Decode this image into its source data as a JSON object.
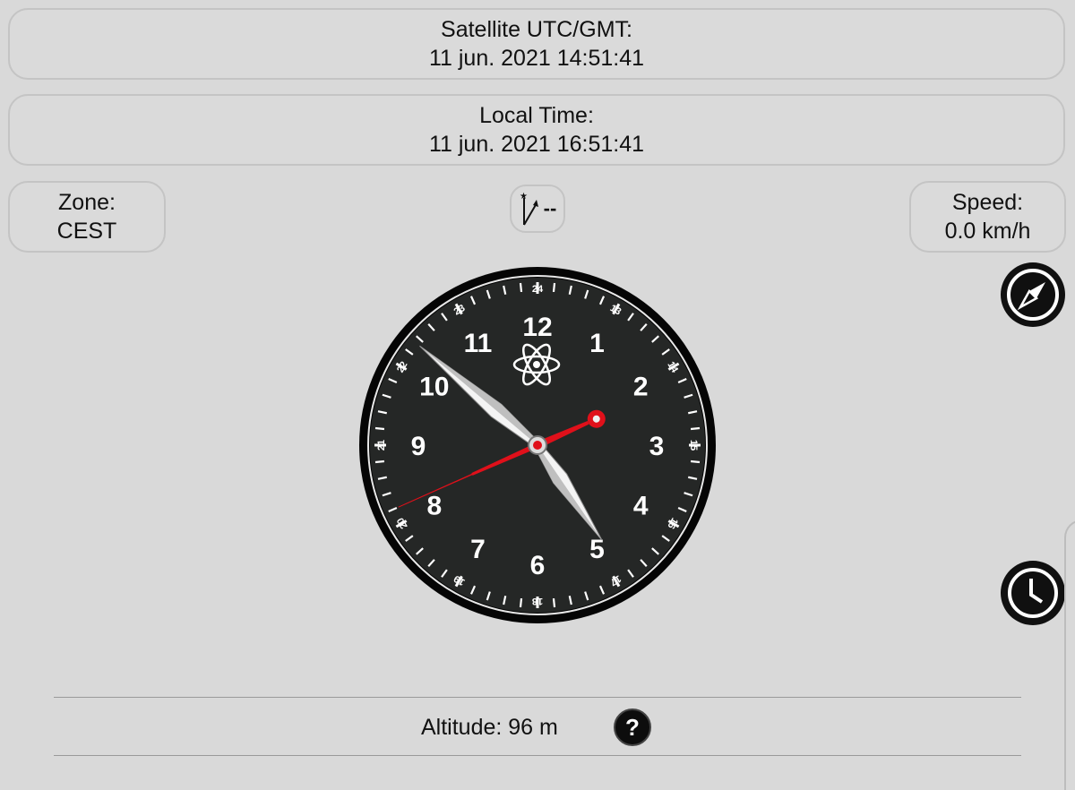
{
  "header": {
    "utc_label": "Satellite UTC/GMT:",
    "utc_value": "11 jun. 2021 14:51:41",
    "local_label": "Local Time:",
    "local_value": "11 jun. 2021 16:51:41"
  },
  "zone": {
    "label": "Zone:",
    "value": "CEST"
  },
  "speed": {
    "label": "Speed:",
    "value": "0.0 km/h"
  },
  "heading": {
    "value": "--",
    "icon": "north-arrow-icon"
  },
  "clock": {
    "hour": 16,
    "minute": 51,
    "second": 41,
    "hour_numbers": [
      "12",
      "1",
      "2",
      "3",
      "4",
      "5",
      "6",
      "7",
      "8",
      "9",
      "10",
      "11"
    ],
    "h24_numbers": [
      "24",
      "13",
      "14",
      "15",
      "16",
      "17",
      "18",
      "19",
      "20",
      "21",
      "22",
      "23"
    ],
    "center_icon": "atom-icon",
    "colors": {
      "face": "#252726",
      "rim": "#000000",
      "second_hand": "#e0101a",
      "text": "#ffffff"
    }
  },
  "footer": {
    "altitude": "Altitude: 96 m",
    "help": "?"
  },
  "buttons": {
    "compass_icon": "compass-icon",
    "clock_icon": "clock-icon",
    "menu_icon": "menu-icon"
  }
}
